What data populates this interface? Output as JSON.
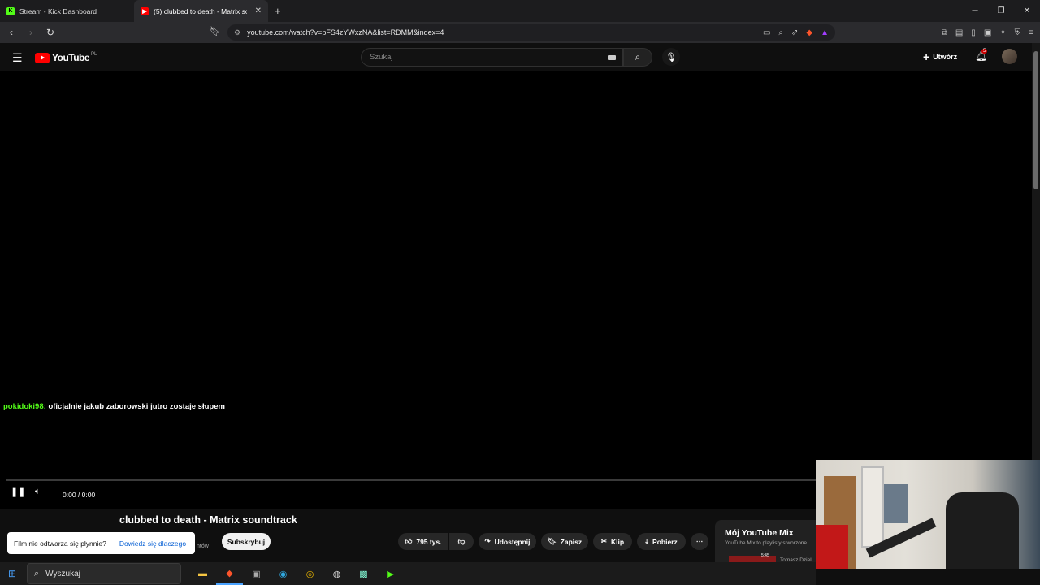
{
  "browser": {
    "tabs": [
      {
        "label": "Stream - Kick Dashboard",
        "favicon": "kick-icon",
        "color": "#53fc18"
      },
      {
        "label": "(5) clubbed to death - Matrix sou",
        "favicon": "youtube-icon",
        "color": "#ff0000"
      }
    ],
    "new_tab": "+",
    "url": "youtube.com/watch?v=pFS4zYWxzNA&list=RDMM&index=4"
  },
  "youtube": {
    "logo": "YouTube",
    "region": "PL",
    "search_placeholder": "Szukaj",
    "create_label": "Utwórz",
    "notifications_count": "5"
  },
  "video": {
    "chat_user": "pokidoki98:",
    "chat_message": "oficjalnie jakub zaborowski jutro zostaje słupem",
    "time": "0:00 / 0:00",
    "progress": 0,
    "title": "clubbed to death - Matrix soundtrack"
  },
  "actions": {
    "toast_text": "Film nie odtwarza się płynnie?",
    "toast_link": "Dowiedz się dlaczego",
    "subscribers_partial": "ntów",
    "subscribe": "Subskrybuj",
    "likes": "795 tys.",
    "share": "Udostępnij",
    "save": "Zapisz",
    "clip": "Klip",
    "download": "Pobierz"
  },
  "mix": {
    "heading": "Mój YouTube Mix",
    "subtitle": "YouTube Mix to playlisty stworzone",
    "thumb_duration": "5:45",
    "channel": "Tomasz Dziel"
  },
  "taskbar": {
    "search": "Wyszukaj"
  },
  "colors": {
    "accent_red": "#ff0000",
    "kick_green": "#53fc18",
    "link_blue": "#065fd4"
  }
}
